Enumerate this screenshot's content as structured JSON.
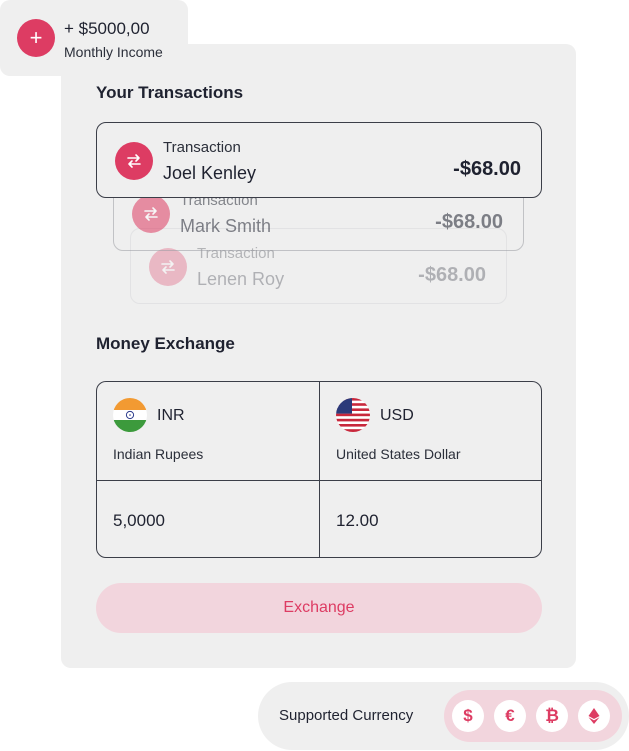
{
  "income": {
    "amount": "+ $5000,00",
    "label": "Monthly Income",
    "add_icon": "plus-icon"
  },
  "transactions_section": {
    "title": "Your Transactions",
    "items": [
      {
        "type_label": "Transaction",
        "name": "Joel Kenley",
        "amount": "-$68.00",
        "icon": "swap-arrows-icon"
      },
      {
        "type_label": "Transaction",
        "name": "Mark Smith",
        "amount": "-$68.00",
        "icon": "swap-arrows-icon"
      },
      {
        "type_label": "Transaction",
        "name": "Lenen Roy",
        "amount": "-$68.00",
        "icon": "swap-arrows-icon"
      }
    ]
  },
  "exchange_section": {
    "title": "Money Exchange",
    "from": {
      "code": "INR",
      "name": "Indian Rupees",
      "value": "5,0000",
      "flag": "india-flag-icon"
    },
    "to": {
      "code": "USD",
      "name": "United States Dollar",
      "value": "12.00",
      "flag": "usa-flag-icon"
    },
    "button_label": "Exchange"
  },
  "supported": {
    "label": "Supported Currency",
    "currencies": [
      {
        "icon": "dollar-icon",
        "glyph": "$"
      },
      {
        "icon": "euro-icon",
        "glyph": "€"
      },
      {
        "icon": "bitcoin-icon",
        "glyph": "₿"
      },
      {
        "icon": "ethereum-icon",
        "glyph": ""
      }
    ]
  },
  "colors": {
    "accent": "#dd3c63",
    "accent_soft": "#f2d5dd",
    "panel": "#efefef",
    "text": "#1f2230"
  }
}
